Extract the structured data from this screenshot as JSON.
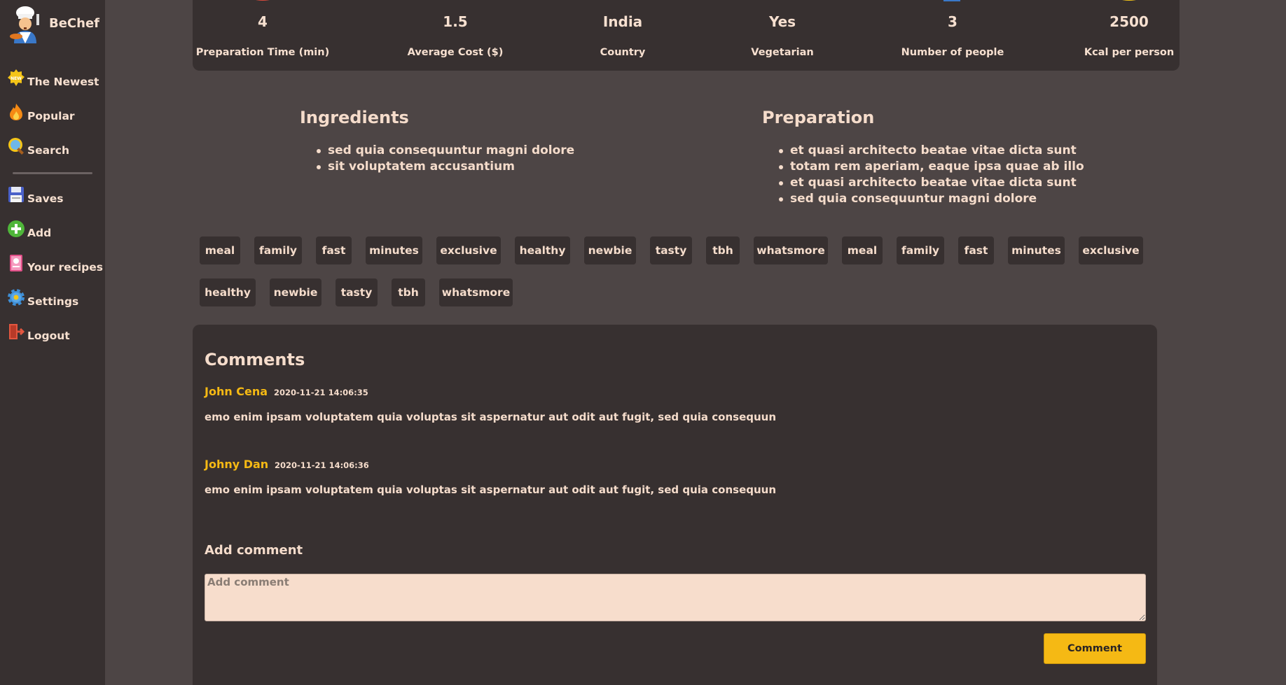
{
  "brand": {
    "name": "BeChef",
    "logo_icon": "chef-logo-icon"
  },
  "sidebar": {
    "items": [
      {
        "label": "The Newest",
        "icon": "new-badge-icon"
      },
      {
        "label": "Popular",
        "icon": "fire-icon"
      },
      {
        "label": "Search",
        "icon": "magnifier-icon"
      },
      {
        "label": "Saves",
        "icon": "floppy-disk-icon"
      },
      {
        "label": "Add",
        "icon": "plus-circle-icon"
      },
      {
        "label": "Your recipes",
        "icon": "recipe-book-icon"
      },
      {
        "label": "Settings",
        "icon": "gear-icon"
      },
      {
        "label": "Logout",
        "icon": "door-exit-icon"
      }
    ]
  },
  "stats": [
    {
      "value": "4",
      "label": "Preparation Time (min)"
    },
    {
      "value": "1.5",
      "label": "Average Cost ($)"
    },
    {
      "value": "India",
      "label": "Country"
    },
    {
      "value": "Yes",
      "label": "Vegetarian"
    },
    {
      "value": "3",
      "label": "Number of people"
    },
    {
      "value": "2500",
      "label": "Kcal per person"
    }
  ],
  "ingredients": {
    "title": "Ingredients",
    "items": [
      "sed quia consequuntur magni dolore",
      "sit voluptatem accusantium"
    ]
  },
  "preparation": {
    "title": "Preparation",
    "items": [
      "et quasi architecto beatae vitae dicta sunt",
      "totam rem aperiam, eaque ipsa quae ab illo",
      "et quasi architecto beatae vitae dicta sunt",
      "sed quia consequuntur magni dolore"
    ]
  },
  "tags": [
    "meal",
    "family",
    "fast",
    "minutes",
    "exclusive",
    "healthy",
    "newbie",
    "tasty",
    "tbh",
    "whatsmore",
    "meal",
    "family",
    "fast",
    "minutes",
    "exclusive",
    "healthy",
    "newbie",
    "tasty",
    "tbh",
    "whatsmore"
  ],
  "comments": {
    "title": "Comments",
    "items": [
      {
        "author": "John Cena",
        "date": "2020-11-21 14:06:35",
        "text": "emo enim ipsam voluptatem quia voluptas sit aspernatur aut odit aut fugit, sed quia consequun"
      },
      {
        "author": "Johny Dan",
        "date": "2020-11-21 14:06:36",
        "text": "emo enim ipsam voluptatem quia voluptas sit aspernatur aut odit aut fugit, sed quia consequun"
      }
    ],
    "add_title": "Add comment",
    "placeholder": "Add comment",
    "button_label": "Comment"
  },
  "colors": {
    "accent": "#f5b914",
    "panel": "#373030",
    "background": "#4d4545",
    "text": "#f5dccb"
  }
}
